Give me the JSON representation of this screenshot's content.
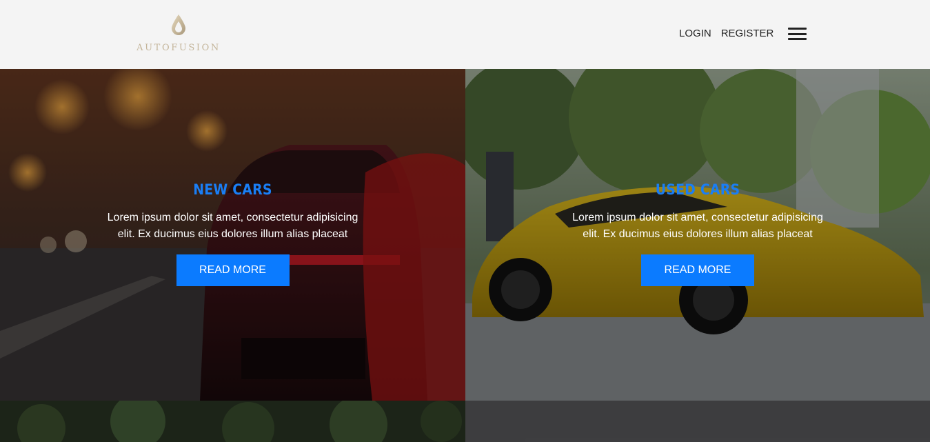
{
  "brand": {
    "name": "AUTOFUSION",
    "logo_icon": "water-drop-icon"
  },
  "nav": {
    "login": "LOGIN",
    "register": "REGISTER",
    "menu_icon": "hamburger-menu-icon"
  },
  "tiles": [
    {
      "title": "NEW CARS",
      "text": "Lorem ipsum dolor sit amet, consectetur adipisicing elit. Ex ducimus eius dolores illum alias placeat",
      "button": "READ MORE"
    },
    {
      "title": "USED CARS",
      "text": "Lorem ipsum dolor sit amet, consectetur adipisicing elit. Ex ducimus eius dolores illum alias placeat",
      "button": "READ MORE"
    }
  ],
  "colors": {
    "accent": "#0b7bff",
    "title": "#1a7ef5",
    "header_bg": "#f4f4f4",
    "logo": "#c4b59a"
  }
}
